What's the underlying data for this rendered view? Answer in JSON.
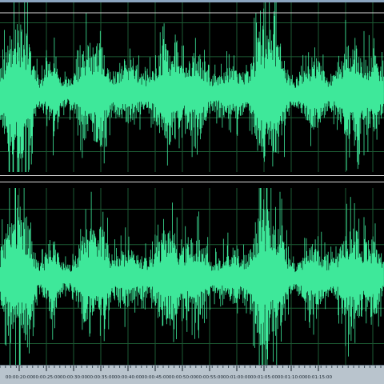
{
  "colors": {
    "waveform": "#3ee89a",
    "background": "#000000",
    "grid": "#1c5a33",
    "ruler_bg": "#b9c4cd",
    "ruler_text": "#17222c",
    "separator": "#d9d9d9"
  },
  "timeline": {
    "tick_labels": [
      "00:00:20:00",
      "00:00:25:00",
      "00:00:30:00",
      "00:00:35:00",
      "00:00:40:00",
      "00:00:45:00",
      "00:00:50:00",
      "00:00:55:00",
      "00:01:00:00",
      "00:01:05:00",
      "00:01:10:00",
      "00:01:15:00"
    ]
  },
  "channels": [
    {
      "id": "left"
    },
    {
      "id": "right"
    }
  ]
}
